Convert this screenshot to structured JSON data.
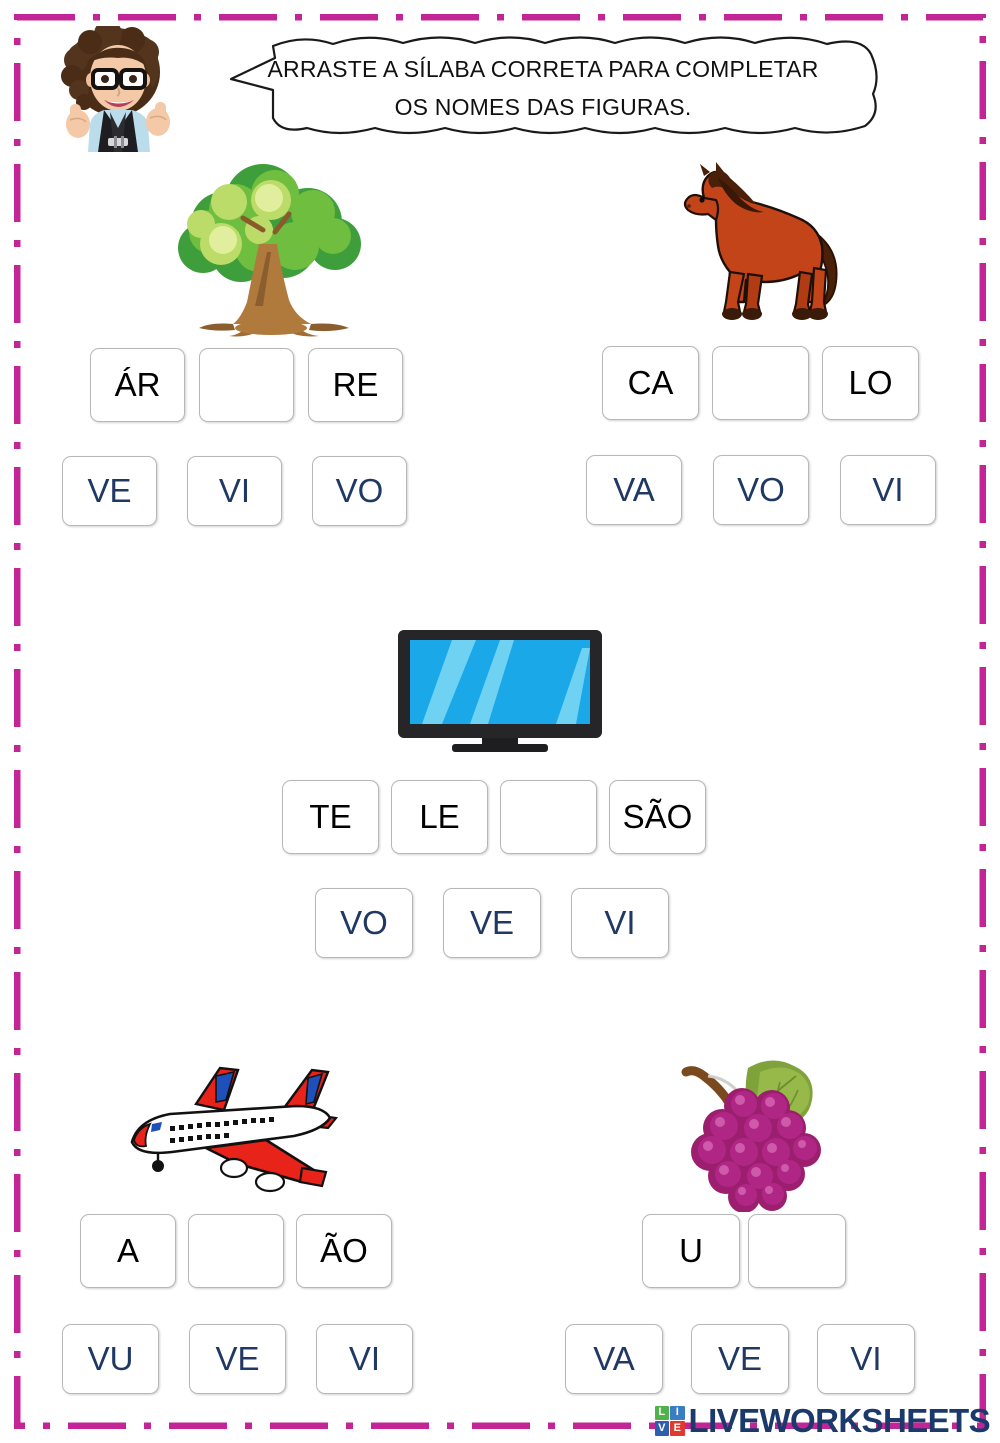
{
  "worksheet": {
    "instruction_line1": "ARRASTE A SÍLABA CORRETA PARA COMPLETAR",
    "instruction_line2": "OS NOMES DAS FIGURAS.",
    "avatar_alt": "teacher-avatar-thumbs-up",
    "border_color": "#C42596",
    "word_text_color": "#000000",
    "option_text_color": "#1F3864"
  },
  "exercises": [
    {
      "id": "tree",
      "picture": "tree-image",
      "answer_word": "ÁRVORE",
      "word_boxes": [
        {
          "text": "ÁR",
          "blank": false
        },
        {
          "text": "",
          "blank": true
        },
        {
          "text": "RE",
          "blank": false
        }
      ],
      "options": [
        "VE",
        "VI",
        "VO"
      ]
    },
    {
      "id": "horse",
      "picture": "horse-image",
      "answer_word": "CAVALO",
      "word_boxes": [
        {
          "text": "CA",
          "blank": false
        },
        {
          "text": "",
          "blank": true
        },
        {
          "text": "LO",
          "blank": false
        }
      ],
      "options": [
        "VA",
        "VO",
        "VI"
      ]
    },
    {
      "id": "television",
      "picture": "television-image",
      "answer_word": "TELEVISÃO",
      "word_boxes": [
        {
          "text": "TE",
          "blank": false
        },
        {
          "text": "LE",
          "blank": false
        },
        {
          "text": "",
          "blank": true
        },
        {
          "text": "SÃO",
          "blank": false
        }
      ],
      "options": [
        "VO",
        "VE",
        "VI"
      ]
    },
    {
      "id": "airplane",
      "picture": "airplane-image",
      "answer_word": "AVIÃO",
      "word_boxes": [
        {
          "text": "A",
          "blank": false
        },
        {
          "text": "",
          "blank": true
        },
        {
          "text": "ÃO",
          "blank": false
        }
      ],
      "options": [
        "VU",
        "VE",
        "VI"
      ]
    },
    {
      "id": "grapes",
      "picture": "grapes-image",
      "answer_word": "UVA",
      "word_boxes": [
        {
          "text": "U",
          "blank": false
        },
        {
          "text": "",
          "blank": true
        }
      ],
      "options": [
        "VA",
        "VE",
        "VI"
      ]
    }
  ],
  "footer": {
    "logo_cells": [
      "LI",
      "VE"
    ],
    "logo_letters": [
      "L",
      "I",
      "V",
      "E"
    ],
    "brand": "LIVEWORKSHEETS"
  }
}
